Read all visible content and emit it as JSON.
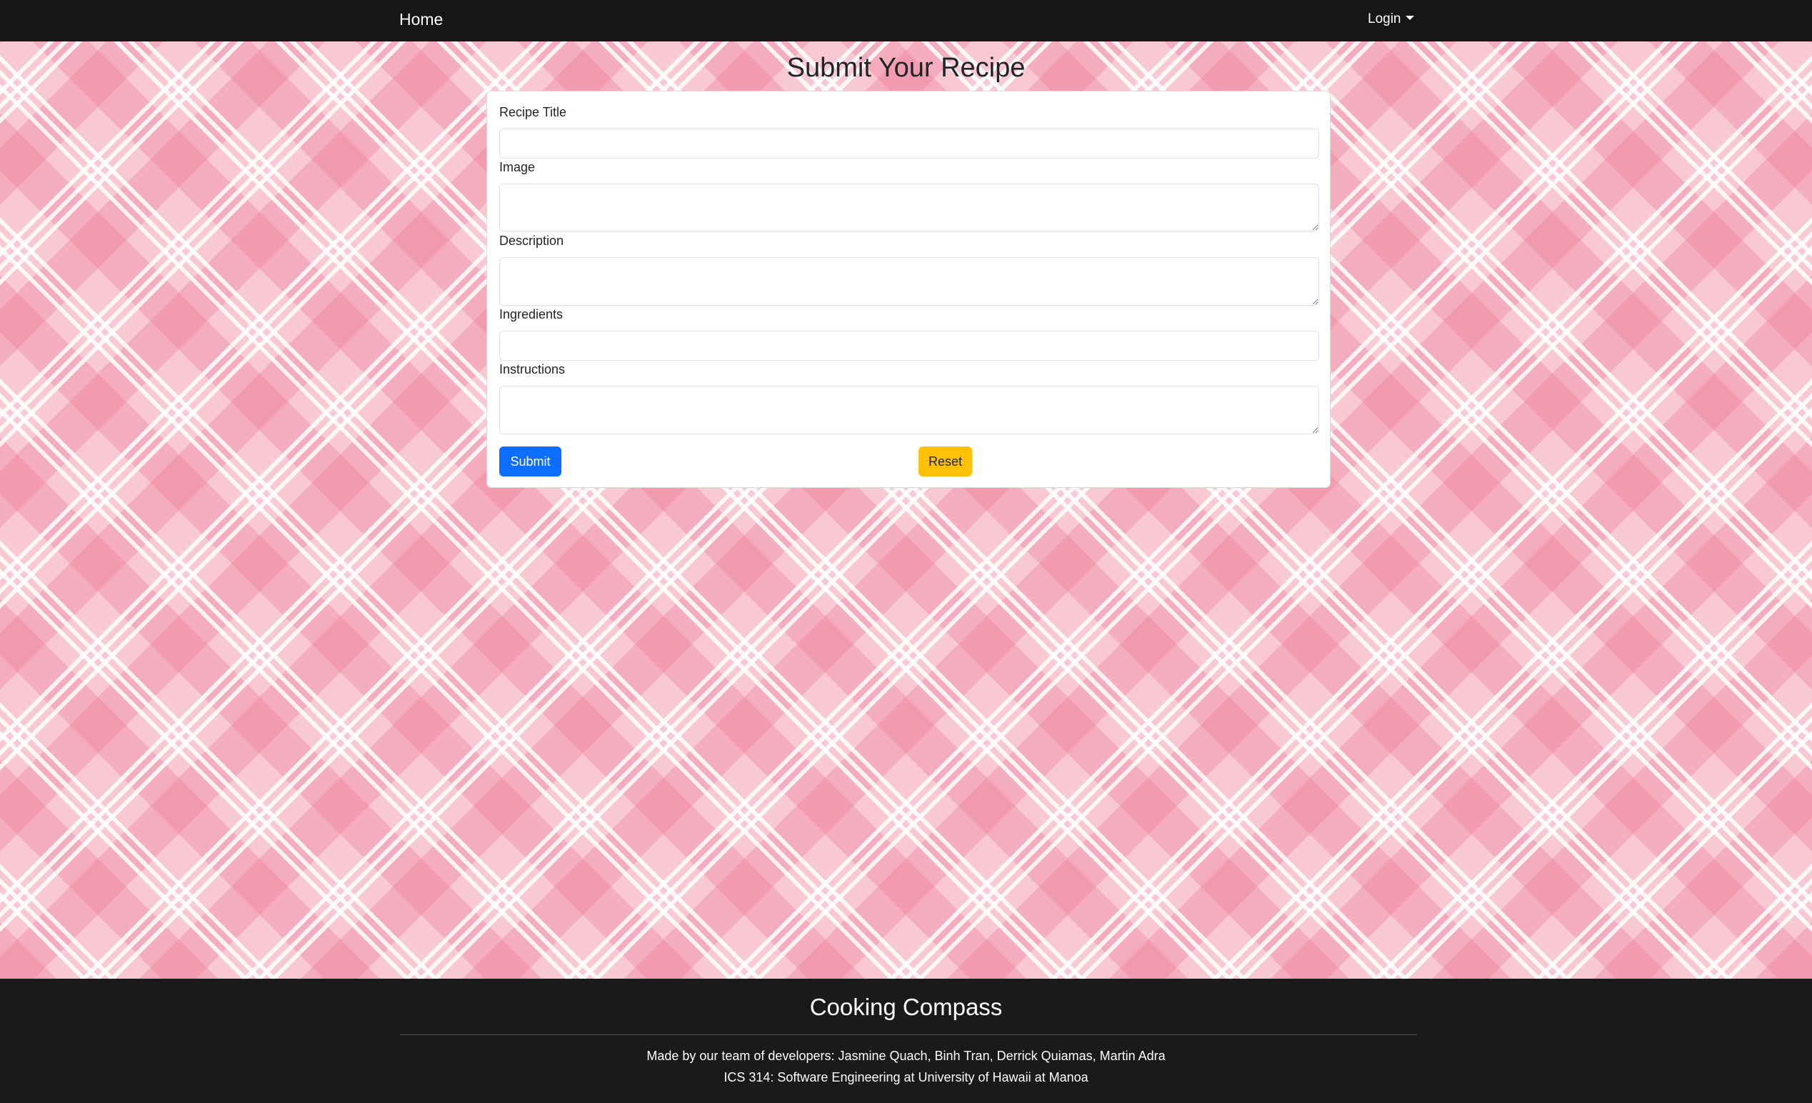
{
  "navbar": {
    "home_label": "Home",
    "login_label": "Login"
  },
  "page": {
    "title": "Submit Your Recipe"
  },
  "form": {
    "fields": [
      {
        "label": "Recipe Title",
        "value": ""
      },
      {
        "label": "Image",
        "value": ""
      },
      {
        "label": "Description",
        "value": ""
      },
      {
        "label": "Ingredients",
        "value": ""
      },
      {
        "label": "Instructions",
        "value": ""
      }
    ],
    "submit_label": "Submit",
    "reset_label": "Reset"
  },
  "footer": {
    "title": "Cooking Compass",
    "credits": "Made by our team of developers: Jasmine Quach, Binh Tran, Derrick Quiamas, Martin Adra",
    "course": "ICS 314: Software Engineering at University of Hawaii at Manoa"
  },
  "colors": {
    "navbar_bg": "#161616",
    "footer_bg": "#1a1a1a",
    "primary": "#0d6efd",
    "warning": "#ffc107",
    "plaid_pink": "#f8c9d3"
  },
  "icons": {
    "login_dropdown": "chevron-down-icon"
  }
}
